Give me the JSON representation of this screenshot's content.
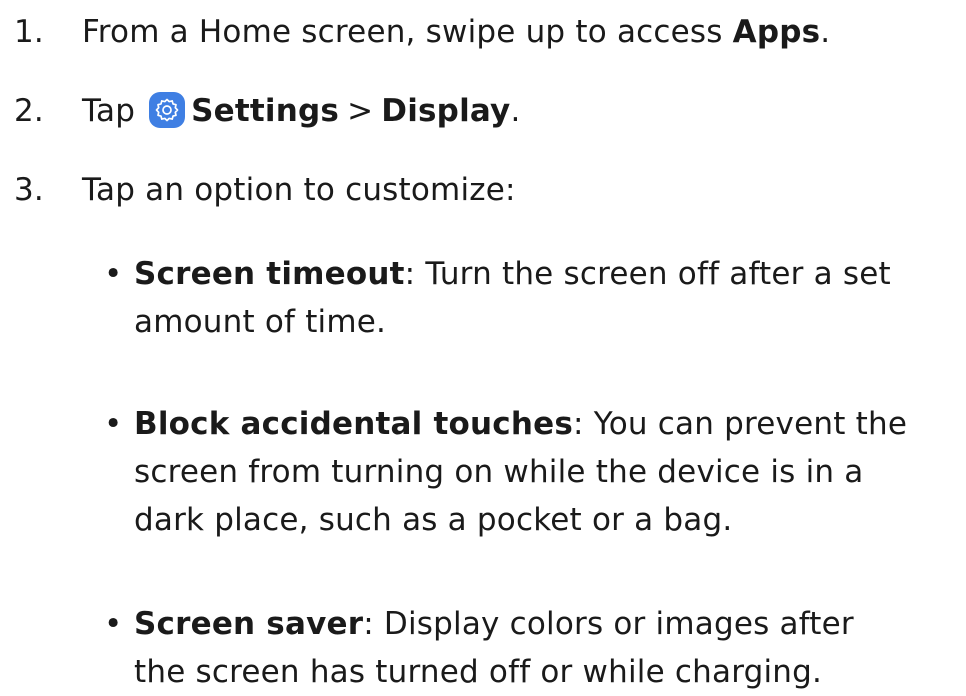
{
  "steps": [
    {
      "number": "1.",
      "text_before": "From a Home screen, swipe up to access ",
      "bold": "Apps",
      "text_after": "."
    },
    {
      "number": "2.",
      "text_before": "Tap ",
      "icon": "settings-gear-icon",
      "bold1": "Settings",
      "separator": ">",
      "bold2": "Display",
      "text_after": "."
    },
    {
      "number": "3.",
      "text": "Tap an option to customize:"
    }
  ],
  "options": [
    {
      "title": "Screen timeout",
      "lines": [
        "Turn the screen off after a set",
        "amount of time."
      ]
    },
    {
      "title": "Block accidental touches",
      "lines": [
        "You can prevent the",
        "screen from turning on while the device is in a",
        "dark place, such as a pocket or a bag."
      ]
    },
    {
      "title": "Screen saver",
      "lines": [
        "Display colors or images after",
        "the screen has turned off or while charging."
      ]
    }
  ],
  "bullet_symbol": "•",
  "colon": ":",
  "colors": {
    "text": "#1a1a1a",
    "icon_background": "#3f7fe3",
    "background": "#ffffff"
  }
}
